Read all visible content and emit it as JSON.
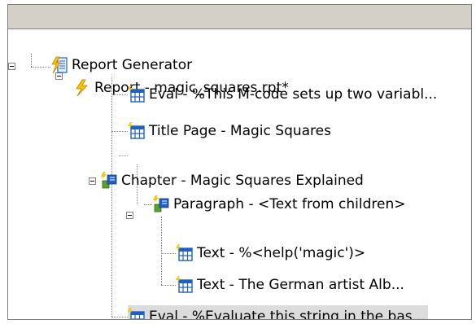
{
  "tree": {
    "nodes": [
      {
        "label": "Report Generator",
        "icon": "report-generator-icon"
      },
      {
        "label": "Report - magic_squares.rpt*",
        "icon": "report-lightning-icon"
      },
      {
        "label": "Eval - %This M-code sets up two variabl...",
        "icon": "table-component-icon"
      },
      {
        "label": "Title Page - Magic Squares",
        "icon": "table-component-icon"
      },
      {
        "label": "Chapter - Magic Squares Explained",
        "icon": "chapter-component-icon"
      },
      {
        "label": "Paragraph - <Text from children>",
        "icon": "chapter-component-icon"
      },
      {
        "label": "Text - %<help('magic')>",
        "icon": "table-component-icon"
      },
      {
        "label": "Text - The German artist Alb...",
        "icon": "table-component-icon"
      },
      {
        "label": "Eval - %Evaluate this string in the bas...",
        "icon": "table-component-icon"
      }
    ]
  },
  "colors": {
    "header": "#d4d0c8",
    "selected_background": "#dcdcdc",
    "icon_blue": "#1f5fbf",
    "icon_yellow": "#f5c400",
    "icon_green": "#5aa02c"
  }
}
